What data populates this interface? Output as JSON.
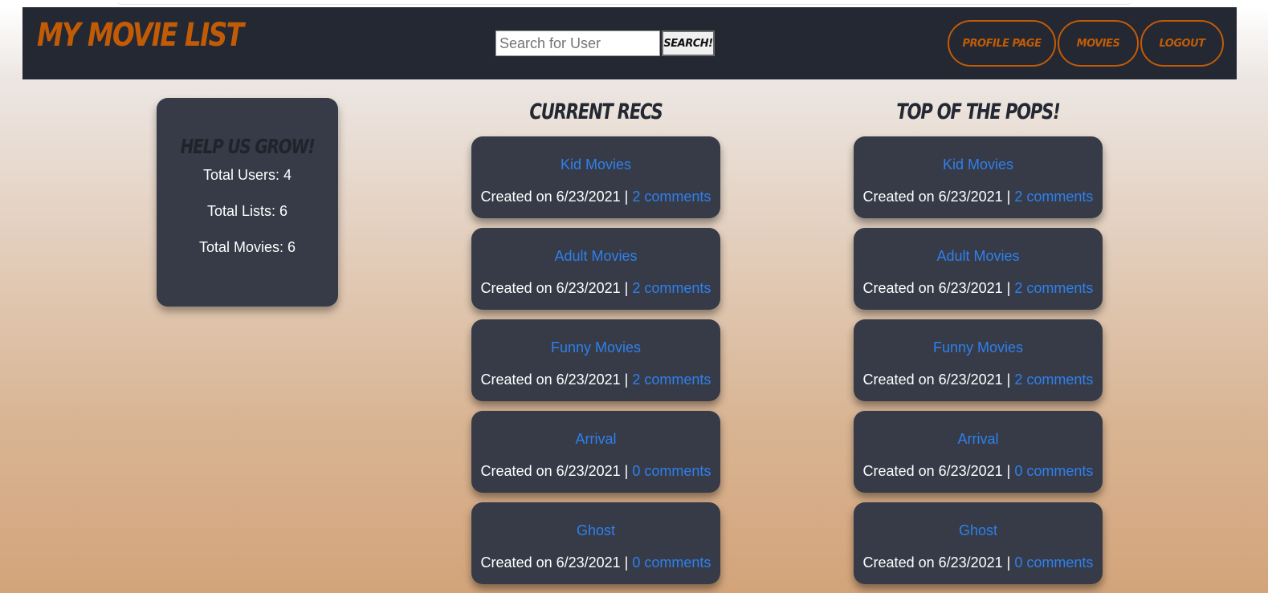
{
  "header": {
    "logo": "My Movie List",
    "search_placeholder": "Search for User",
    "search_button": "Search!",
    "nav": [
      {
        "label": "Profile Page"
      },
      {
        "label": "Movies"
      },
      {
        "label": "Logout"
      }
    ]
  },
  "stats": {
    "title": "Help Us Grow!",
    "lines": [
      "Total Users: 4",
      "Total Lists: 6",
      "Total Movies: 6"
    ]
  },
  "columns": [
    {
      "title": "Current Recs",
      "items": [
        {
          "name": "Kid Movies",
          "created": "Created on 6/23/2021 |",
          "comments": "2 comments"
        },
        {
          "name": "Adult Movies",
          "created": "Created on 6/23/2021 |",
          "comments": "2 comments"
        },
        {
          "name": "Funny Movies",
          "created": "Created on 6/23/2021 |",
          "comments": "2 comments"
        },
        {
          "name": "Arrival",
          "created": "Created on 6/23/2021 |",
          "comments": "0 comments"
        },
        {
          "name": "Ghost",
          "created": "Created on 6/23/2021 |",
          "comments": "0 comments"
        }
      ]
    },
    {
      "title": "Top of the Pops!",
      "items": [
        {
          "name": "Kid Movies",
          "created": "Created on 6/23/2021 |",
          "comments": "2 comments"
        },
        {
          "name": "Adult Movies",
          "created": "Created on 6/23/2021 |",
          "comments": "2 comments"
        },
        {
          "name": "Funny Movies",
          "created": "Created on 6/23/2021 |",
          "comments": "2 comments"
        },
        {
          "name": "Arrival",
          "created": "Created on 6/23/2021 |",
          "comments": "0 comments"
        },
        {
          "name": "Ghost",
          "created": "Created on 6/23/2021 |",
          "comments": "0 comments"
        }
      ]
    }
  ],
  "colors": {
    "navbar": "#232833",
    "accent": "#c25b06",
    "card": "#363b47",
    "link": "#2f80ed"
  }
}
